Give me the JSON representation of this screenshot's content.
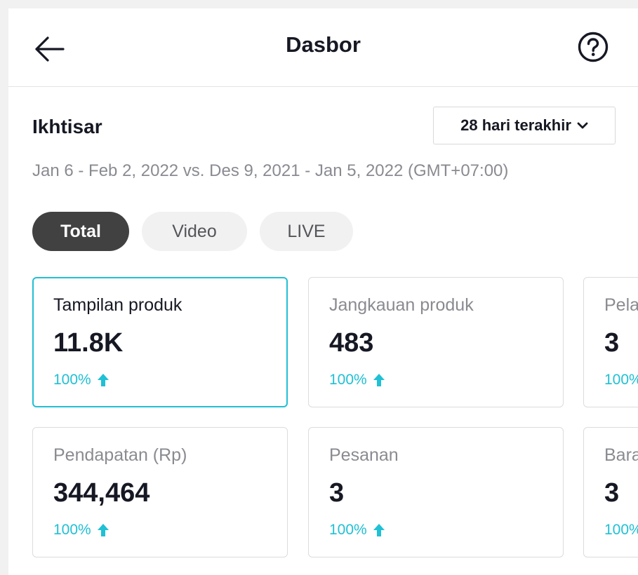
{
  "header": {
    "title": "Dasbor",
    "back_icon": "arrow-left-icon",
    "help_icon": "question-circle-icon"
  },
  "overview": {
    "title": "Ikhtisar",
    "range_select": {
      "value": "28 hari terakhir",
      "icon": "chevron-down-icon"
    },
    "date_range": "Jan 6 - Feb 2, 2022 vs. Des 9, 2021 - Jan 5, 2022 (GMT+07:00)"
  },
  "tabs": [
    {
      "label": "Total",
      "active": true
    },
    {
      "label": "Video",
      "active": false
    },
    {
      "label": "LIVE",
      "active": false
    }
  ],
  "metrics": [
    {
      "label": "Tampilan produk",
      "value": "11.8K",
      "change": "100%",
      "selected": true
    },
    {
      "label": "Jangkauan produk",
      "value": "483",
      "change": "100%"
    },
    {
      "label": "Pelanggan",
      "value": "3",
      "change": "100%"
    },
    {
      "label": "Pendapatan (Rp)",
      "value": "344,464",
      "change": "100%"
    },
    {
      "label": "Pesanan",
      "value": "3",
      "change": "100%"
    },
    {
      "label": "Barang terjual",
      "value": "3",
      "change": "100%"
    }
  ],
  "colors": {
    "accent": "#20c0d5",
    "active_pill": "#414142",
    "muted_text": "#8a8b91"
  }
}
